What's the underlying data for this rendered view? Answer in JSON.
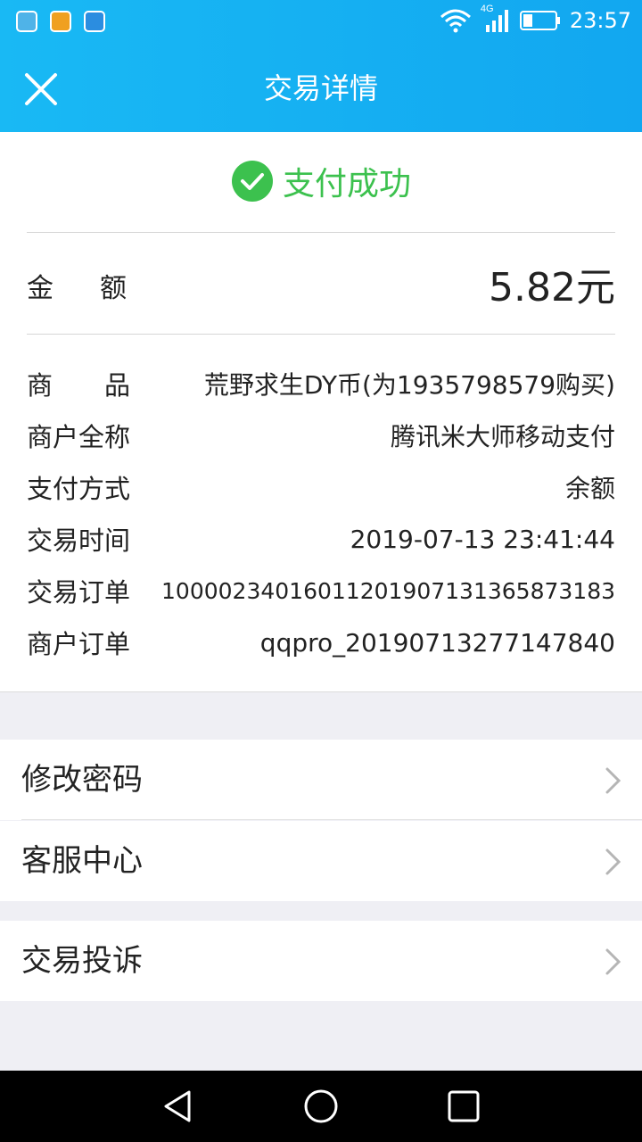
{
  "status_bar": {
    "time": "23:57",
    "network": "4G",
    "app_icons": [
      "cleaner-app-icon",
      "map-app-icon",
      "health-app-icon"
    ]
  },
  "header": {
    "title": "交易详情",
    "close_icon": "close-icon"
  },
  "payment": {
    "status_text": "支付成功",
    "status_color": "#3cc14e",
    "amount_label": "金额",
    "amount_value": "5.82元"
  },
  "details": [
    {
      "label": "商品",
      "value": "荒野求生DY币(为1935798579购买)"
    },
    {
      "label": "商户全称",
      "value": "腾讯米大师移动支付"
    },
    {
      "label": "支付方式",
      "value": "余额"
    },
    {
      "label": "交易时间",
      "value": "2019-07-13 23:41:44"
    },
    {
      "label": "交易订单",
      "value": "10000234016011201907131365873183"
    },
    {
      "label": "商户订单",
      "value": "qqpro_20190713277147840"
    }
  ],
  "menu": [
    {
      "label": "修改密码"
    },
    {
      "label": "客服中心"
    },
    {
      "label": "交易投诉"
    }
  ],
  "colors": {
    "header_bg": "#12a7f0",
    "success": "#3cc14e",
    "page_bg": "#efeff4"
  }
}
